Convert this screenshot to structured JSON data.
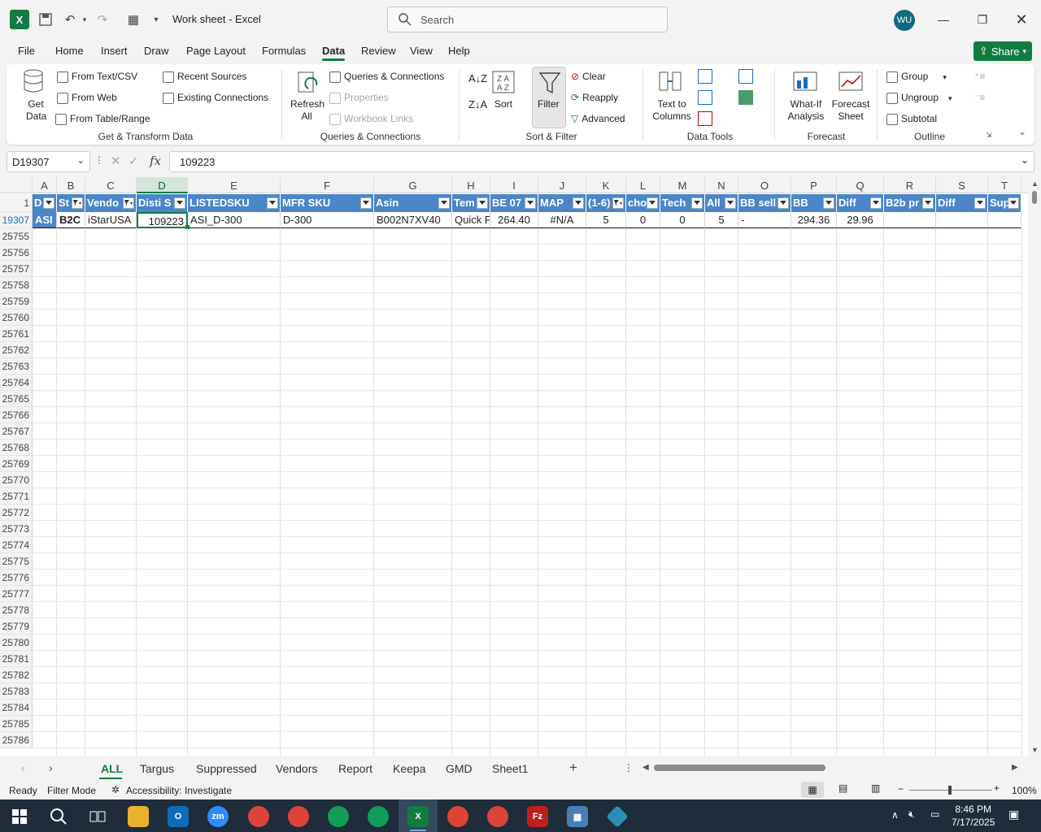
{
  "titlebar": {
    "doc_title": "Work sheet  -  Excel",
    "search_placeholder": "Search",
    "avatar_initials": "WU"
  },
  "menu": {
    "items": [
      "File",
      "Home",
      "Insert",
      "Draw",
      "Page Layout",
      "Formulas",
      "Data",
      "Review",
      "View",
      "Help"
    ],
    "active": "Data",
    "share_label": "Share"
  },
  "ribbon": {
    "get_data": "Get Data",
    "from_text_csv": "From Text/CSV",
    "from_web": "From Web",
    "from_table_range": "From Table/Range",
    "recent_sources": "Recent Sources",
    "existing_connections": "Existing Connections",
    "group_get_transform": "Get & Transform Data",
    "refresh_all": "Refresh All",
    "queries_connections": "Queries & Connections",
    "properties": "Properties",
    "workbook_links": "Workbook Links",
    "group_queries": "Queries & Connections",
    "sort": "Sort",
    "filter": "Filter",
    "clear": "Clear",
    "reapply": "Reapply",
    "advanced": "Advanced",
    "group_sort_filter": "Sort & Filter",
    "text_to_columns": "Text to Columns",
    "group_data_tools": "Data Tools",
    "what_if": "What-If Analysis",
    "forecast_sheet": "Forecast Sheet",
    "group_forecast": "Forecast",
    "group": "Group",
    "ungroup": "Ungroup",
    "subtotal": "Subtotal",
    "group_outline": "Outline"
  },
  "formula_bar": {
    "name_box": "D19307",
    "fx": "fx",
    "value": "109223"
  },
  "grid": {
    "columns": [
      "A",
      "B",
      "C",
      "D",
      "E",
      "F",
      "G",
      "H",
      "I",
      "J",
      "K",
      "L",
      "M",
      "N",
      "O",
      "P",
      "Q",
      "R",
      "S",
      "T"
    ],
    "header_row_number": "1",
    "headers": [
      "D",
      "St",
      "Vendo",
      "Disti S",
      "LISTEDSKU",
      "MFR SKU",
      "Asin",
      "Tem",
      "BE 07",
      "MAP",
      "(1-6)",
      "cho",
      "Tech",
      "All",
      "BB sell",
      "BB",
      "Diff",
      "B2b pr",
      "Diff",
      "Sup"
    ],
    "data_row_number": "19307",
    "data_row": [
      "ASI",
      "B2C",
      "iStarUSA",
      "109223",
      "ASI_D-300",
      "D-300",
      "B002N7XV40",
      "Quick F",
      "264.40",
      "#N/A",
      "5",
      "0",
      "0",
      "5",
      "-",
      "294.36",
      "29.96",
      "",
      "",
      ""
    ],
    "row_numbers": [
      "25755",
      "25756",
      "25757",
      "25758",
      "25759",
      "25760",
      "25761",
      "25762",
      "25763",
      "25764",
      "25765",
      "25766",
      "25767",
      "25768",
      "25769",
      "25770",
      "25771",
      "25772",
      "25773",
      "25774",
      "25775",
      "25776",
      "25777",
      "25778",
      "25779",
      "25780",
      "25781",
      "25782",
      "25783",
      "25784",
      "25785",
      "25786"
    ]
  },
  "sheet_tabs": {
    "tabs": [
      "ALL",
      "Targus",
      "Suppressed",
      "Vendors",
      "Report",
      "Keepa",
      "GMD",
      "Sheet1"
    ],
    "active": "ALL"
  },
  "status_bar": {
    "ready": "Ready",
    "filter_mode": "Filter Mode",
    "accessibility": "Accessibility: Investigate",
    "zoom": "100%"
  },
  "taskbar": {
    "time": "8:46 PM",
    "date": "7/17/2025"
  },
  "colors": {
    "accent_green": "#107c41",
    "header_blue": "#4a86c8"
  }
}
